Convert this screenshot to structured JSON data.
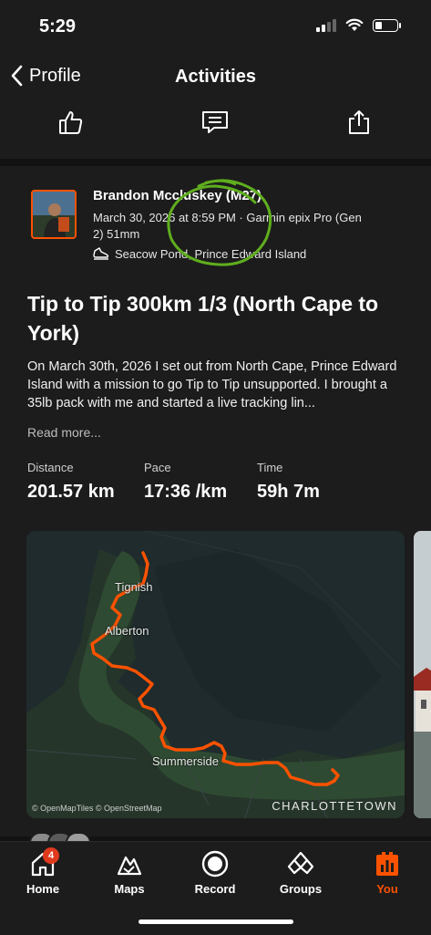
{
  "status_bar": {
    "time": "5:29"
  },
  "nav": {
    "back_label": "Profile",
    "title": "Activities"
  },
  "activity": {
    "athlete_name": "Brandon Mccluskey (M27)",
    "meta": "March 30, 2026 at 8:59 PM · Garmin epix Pro (Gen 2) 51mm",
    "location": "Seacow Pond, Prince Edward Island",
    "title": "Tip to Tip 300km 1/3 (North Cape to York)",
    "description": "On March 30th, 2026 I set out from North Cape, Prince Edward Island with a mission to go Tip to Tip unsupported. I brought a 35lb pack with me and started a live tracking lin...",
    "read_more": "Read more...",
    "stats": [
      {
        "label": "Distance",
        "value": "201.57 km"
      },
      {
        "label": "Pace",
        "value": "17:36 /km"
      },
      {
        "label": "Time",
        "value": "59h 7m"
      }
    ]
  },
  "map": {
    "places": [
      "Tignish",
      "Alberton",
      "Summerside",
      "CHARLOTTETOWN"
    ],
    "attribution": "© OpenMapTiles © OpenStreetMap",
    "route_color": "#fc5200"
  },
  "tabs": [
    {
      "label": "Home",
      "icon": "home-icon",
      "badge": "4"
    },
    {
      "label": "Maps",
      "icon": "maps-icon"
    },
    {
      "label": "Record",
      "icon": "record-icon"
    },
    {
      "label": "Groups",
      "icon": "groups-icon"
    },
    {
      "label": "You",
      "icon": "you-icon"
    }
  ],
  "colors": {
    "accent": "#fc5200",
    "background": "#121212",
    "surface": "#1c1c1c",
    "badge": "#e03a1e",
    "annotation_circle": "#5fae1e"
  }
}
